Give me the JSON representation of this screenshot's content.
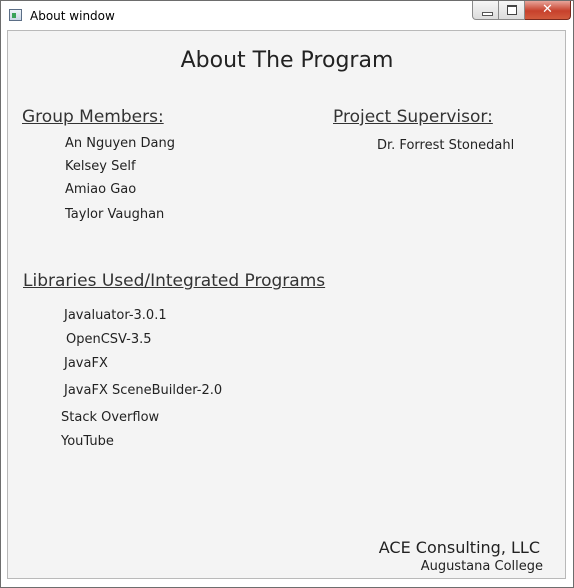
{
  "window": {
    "title": "About window",
    "close_glyph": "✕"
  },
  "content": {
    "heading": "About The Program",
    "group_members": {
      "header": "Group Members:",
      "items": [
        "An Nguyen Dang",
        "Kelsey Self",
        "Amiao Gao",
        "Taylor Vaughan"
      ]
    },
    "supervisor": {
      "header": "Project Supervisor:",
      "name": "Dr. Forrest Stonedahl"
    },
    "libraries": {
      "header": "Libraries Used/Integrated Programs",
      "items": [
        "Javaluator-3.0.1",
        "OpenCSV-3.5",
        "JavaFX",
        "JavaFX SceneBuilder-2.0",
        "Stack Overflow",
        "YouTube"
      ]
    },
    "footer": {
      "company": "ACE Consulting, LLC",
      "college": "Augustana College"
    }
  }
}
